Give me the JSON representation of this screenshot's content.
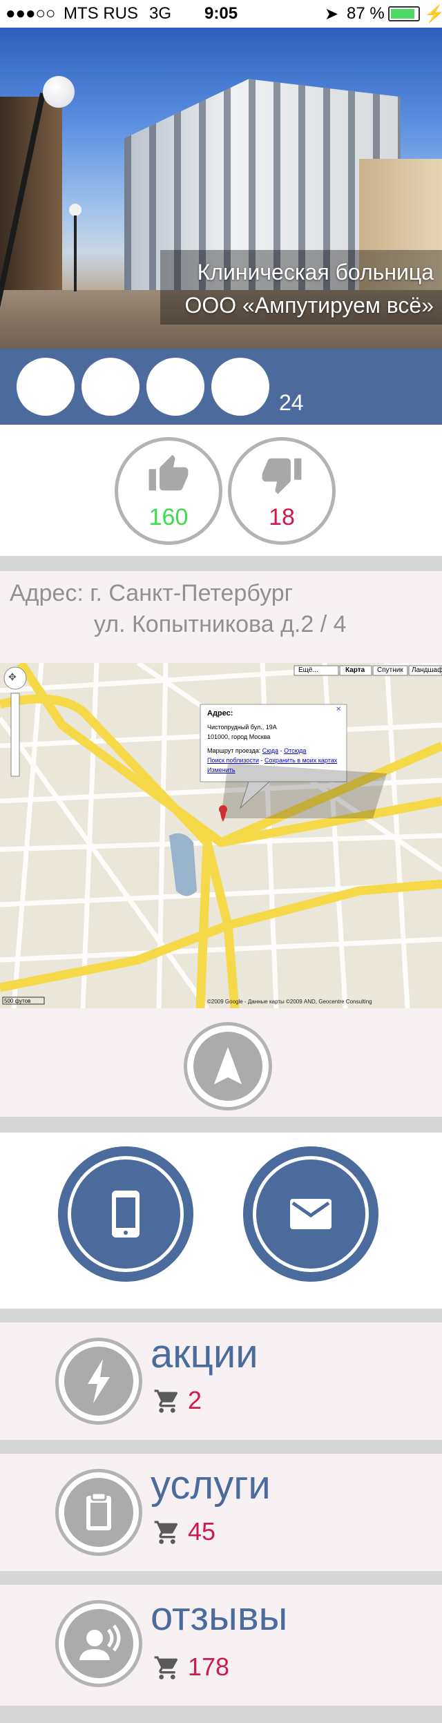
{
  "status_bar": {
    "signal": "●●●○○",
    "carrier": "MTS RUS",
    "network": "3G",
    "time": "9:05",
    "battery_percent": "87 %"
  },
  "hero": {
    "title_line1": "Клиническая больница",
    "title_line2": "ООО «Ампутируем всё»"
  },
  "rating": {
    "stars_filled": 0,
    "stars_total": 4,
    "count": "24"
  },
  "votes": {
    "likes": "160",
    "dislikes": "18",
    "like_color": "#3ddc4a",
    "dislike_color": "#d1194d"
  },
  "address": {
    "line1": "Адрес: г. Санкт-Петербург",
    "line2": "ул. Копытникова д.2 / 4"
  },
  "map": {
    "buttons": [
      "Ещё...",
      "Карта",
      "Спутник",
      "Ландшафт"
    ],
    "popup_title": "Адрес:",
    "popup_line1": "Чистопрудный бул., 19А",
    "popup_line2": "101000, город Москва",
    "popup_route_label": "Маршрут проезда:",
    "popup_route_to": "Сюда",
    "popup_route_from": "Отсюда",
    "popup_search": "Поиск поблизости",
    "popup_save": "Сохранить в моих картах",
    "popup_edit": "Изменить",
    "scale": "500 футов",
    "copyright": "©2009 Google - Данные карты ©2009 AND, Geocentre Consulting"
  },
  "sections": [
    {
      "title": "акции",
      "count": "2",
      "icon": "lightning-icon"
    },
    {
      "title": "услуги",
      "count": "45",
      "icon": "clipboard-icon"
    },
    {
      "title": "отзывы",
      "count": "178",
      "icon": "speaker-person-icon"
    }
  ],
  "colors": {
    "accent_blue": "#4a6b9c",
    "count_red": "#d1194d",
    "icon_gray": "#ababab",
    "background": "#f7f1f3"
  }
}
